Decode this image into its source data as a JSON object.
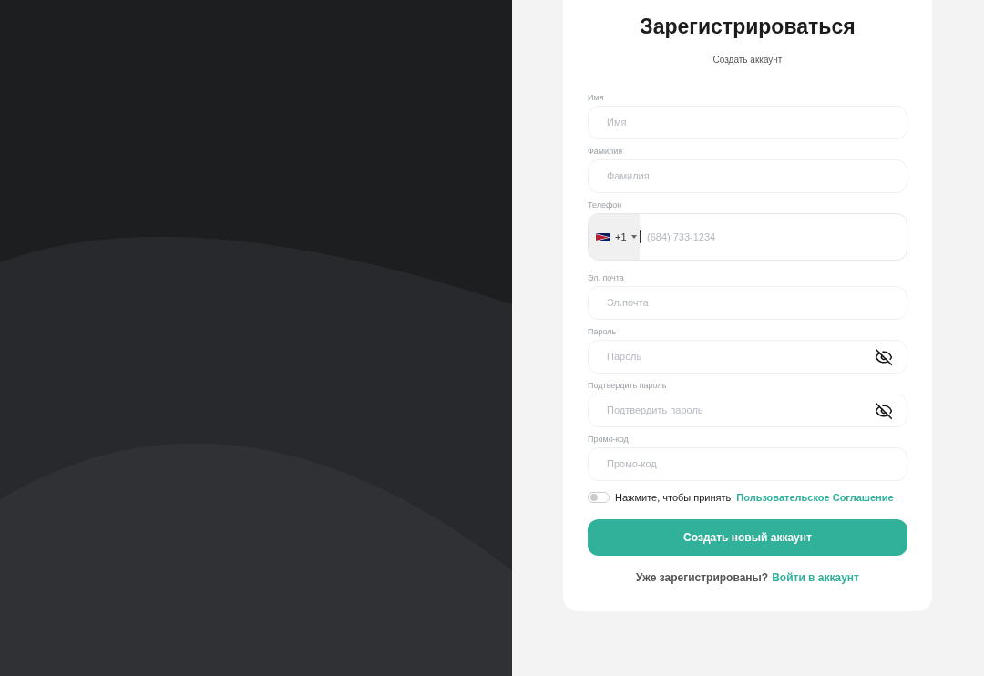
{
  "title": "Зарегистрироваться",
  "subtitle": "Создать аккаунт",
  "fields": [
    {
      "kind": "text",
      "label": "Имя",
      "placeholder": "Имя"
    },
    {
      "kind": "text",
      "label": "Фамилия",
      "placeholder": "Фамилия"
    },
    {
      "kind": "phone",
      "label": "Телефон",
      "code": "+1",
      "placeholder": "(684) 733-1234"
    },
    {
      "kind": "text",
      "label": "Эл. почта",
      "placeholder": "Эл.почта"
    },
    {
      "kind": "password",
      "label": "Пароль",
      "placeholder": "Пароль"
    },
    {
      "kind": "password",
      "label": "Подтвердить пароль",
      "placeholder": "Подтвердить пароль"
    },
    {
      "kind": "text",
      "label": "Промо-код",
      "placeholder": "Промо-код"
    }
  ],
  "agreement": {
    "on": false,
    "text": "Нажмите, чтобы принять",
    "link": "Пользовательское Соглашение"
  },
  "submit": "Создать новый аккаунт",
  "footer": {
    "text": "Уже зарегистрированы?",
    "link": "Войти в аккаунт"
  }
}
